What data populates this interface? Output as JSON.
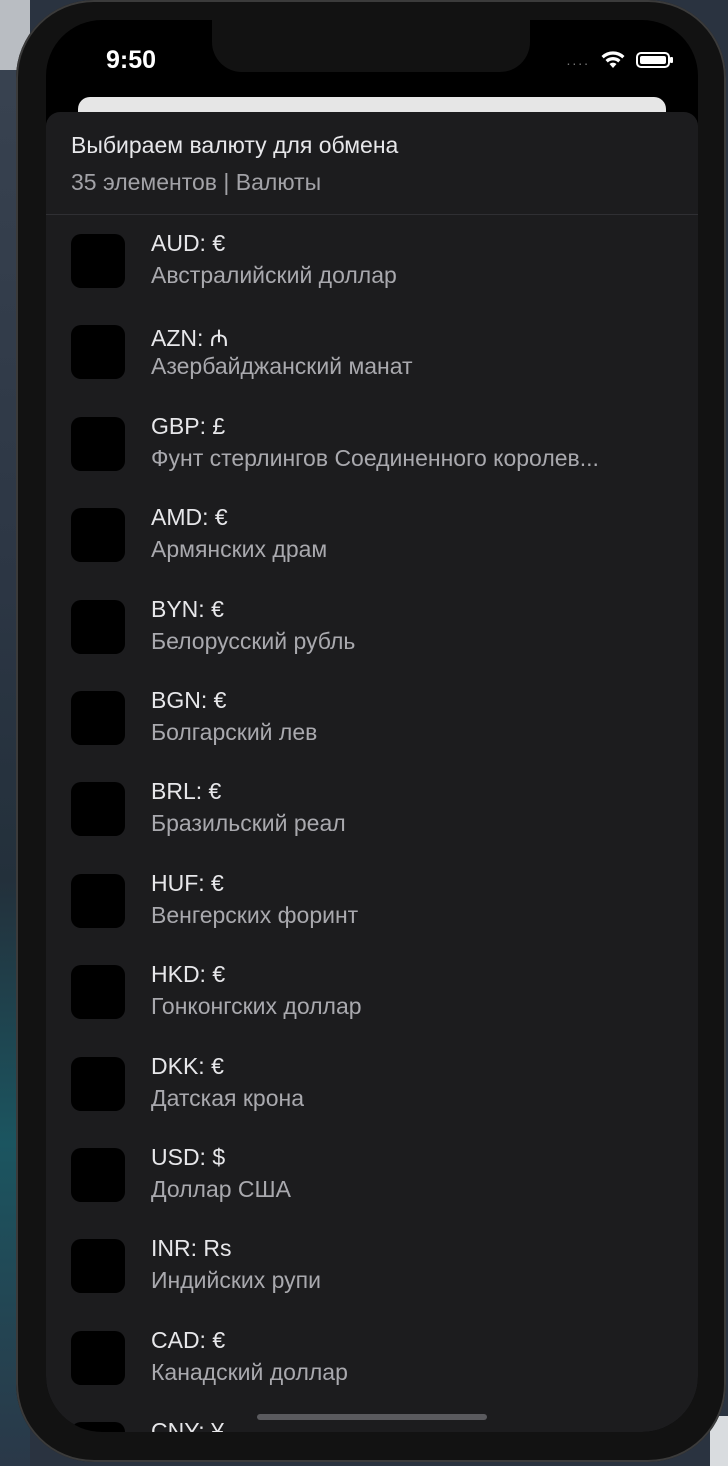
{
  "status_bar": {
    "time": "9:50",
    "signal": "...."
  },
  "sheet": {
    "title": "Выбираем валюту для обмена",
    "subtitle": "35 элементов  |  Валюты"
  },
  "currencies": [
    {
      "code": "AUD: €",
      "name": "Австралийский доллар"
    },
    {
      "code": "AZN: ₼",
      "name": "Азербайджанский манат"
    },
    {
      "code": "GBP: £",
      "name": "Фунт стерлингов Соединенного королев..."
    },
    {
      "code": "AMD: €",
      "name": "Армянских драм"
    },
    {
      "code": "BYN: €",
      "name": "Белорусский рубль"
    },
    {
      "code": "BGN: €",
      "name": "Болгарский лев"
    },
    {
      "code": "BRL: €",
      "name": "Бразильский реал"
    },
    {
      "code": "HUF: €",
      "name": "Венгерских форинт"
    },
    {
      "code": "HKD: €",
      "name": "Гонконгских доллар"
    },
    {
      "code": "DKK: €",
      "name": "Датская крона"
    },
    {
      "code": "USD: $",
      "name": "Доллар США"
    },
    {
      "code": "INR: Rs",
      "name": "Индийских рупи"
    },
    {
      "code": "CAD: €",
      "name": "Канадский доллар"
    },
    {
      "code": "CNY: ¥",
      "name": ""
    }
  ]
}
